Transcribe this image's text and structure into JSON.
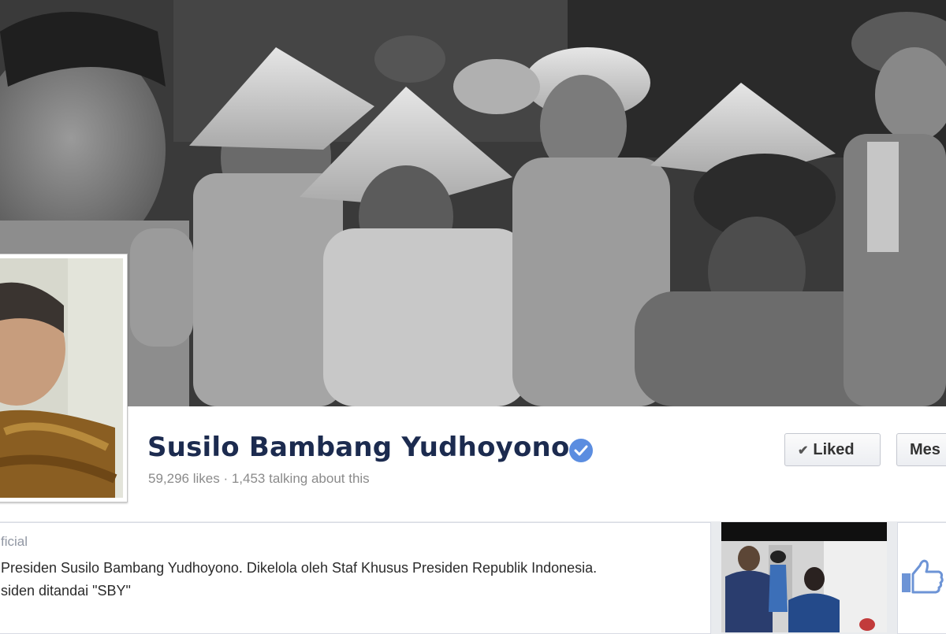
{
  "page": {
    "name": "Susilo Bambang Yudhoyono",
    "verified": true,
    "stats": "59,296 likes · 1,453 talking about this"
  },
  "actions": {
    "liked_label": "Liked",
    "message_label": "Mes"
  },
  "about": {
    "category": "ficial",
    "description_line1": "Presiden Susilo Bambang Yudhoyono. Dikelola oleh Staf Khusus Presiden Republik Indonesia.",
    "description_line2": "siden ditandai \"SBY\""
  },
  "icons": {
    "verified": "verified-badge-icon",
    "liked_check": "check-icon",
    "likes": "thumbs-up-icon"
  },
  "colors": {
    "name": "#1c2b4f",
    "verified_badge": "#5b8de0",
    "thumbs_up": "#6d94d6",
    "muted_text": "#8b8b8b",
    "background": "#e9ebee"
  }
}
